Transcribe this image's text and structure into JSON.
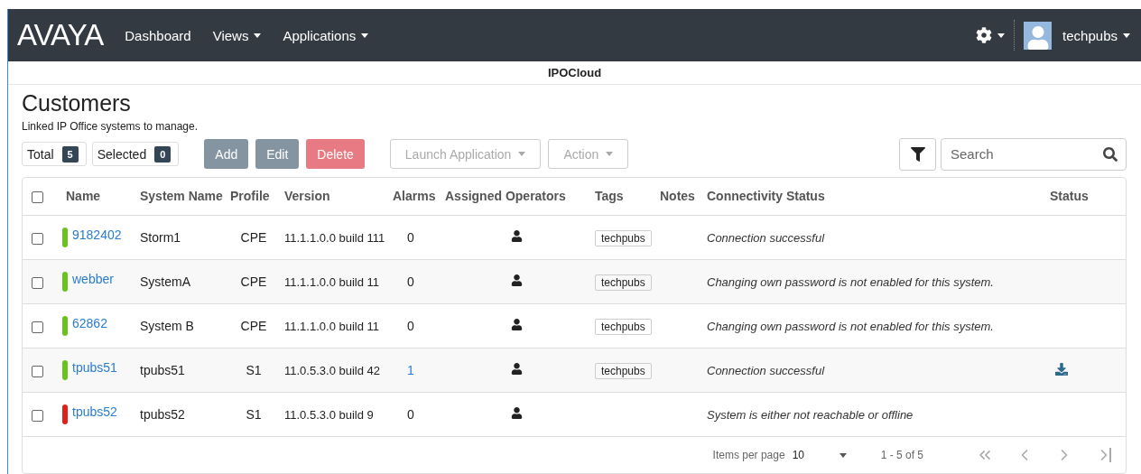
{
  "navbar": {
    "logo": "AVAYA",
    "items": [
      {
        "label": "Dashboard",
        "dropdown": false
      },
      {
        "label": "Views",
        "dropdown": true
      },
      {
        "label": "Applications",
        "dropdown": true
      }
    ],
    "user": "techpubs"
  },
  "context_title": "IPOCloud",
  "page": {
    "title": "Customers",
    "subtitle": "Linked IP Office systems to manage."
  },
  "toolbar": {
    "counters": [
      {
        "label": "Total",
        "count": "5"
      },
      {
        "label": "Selected",
        "count": "0"
      }
    ],
    "buttons": [
      {
        "label": "Add",
        "kind": "secondary",
        "disabled": false
      },
      {
        "label": "Edit",
        "kind": "secondary",
        "disabled": false
      },
      {
        "label": "Delete",
        "kind": "danger",
        "disabled": false
      }
    ],
    "dropdowns": [
      {
        "label": "Launch Application",
        "disabled": true
      },
      {
        "label": "Action",
        "disabled": true
      }
    ],
    "search": {
      "placeholder": "Search"
    }
  },
  "table": {
    "select_all": {
      "checked": false
    },
    "columns": [
      "Name",
      "System Name",
      "Profile",
      "Version",
      "Alarms",
      "Assigned Operators",
      "Tags",
      "Notes",
      "Connectivity Status",
      "Status"
    ],
    "rows": [
      {
        "checked": false,
        "color": "#6ac21c",
        "name": "9182402",
        "system_name": "Storm1",
        "profile": "CPE",
        "version": "11.1.1.0.0 build 111",
        "alarms": "0",
        "alarms_link": false,
        "tags": [
          "techpubs"
        ],
        "connectivity": "Connection successful",
        "download": false
      },
      {
        "checked": false,
        "color": "#6ac21c",
        "name": "webber",
        "system_name": "SystemA",
        "profile": "CPE",
        "version": "11.1.1.0.0 build 11",
        "alarms": "0",
        "alarms_link": false,
        "tags": [
          "techpubs"
        ],
        "connectivity": "Changing own password is not enabled for this system.",
        "download": false
      },
      {
        "checked": false,
        "color": "#6ac21c",
        "name": "62862",
        "system_name": "System B",
        "profile": "CPE",
        "version": "11.1.1.0.0 build 11",
        "alarms": "0",
        "alarms_link": false,
        "tags": [
          "techpubs"
        ],
        "connectivity": "Changing own password is not enabled for this system.",
        "download": false
      },
      {
        "checked": false,
        "color": "#6ac21c",
        "name": "tpubs51",
        "system_name": "tpubs51",
        "profile": "S1",
        "version": "11.0.5.3.0 build 42",
        "alarms": "1",
        "alarms_link": true,
        "tags": [
          "techpubs"
        ],
        "connectivity": "Connection successful",
        "download": true
      },
      {
        "checked": false,
        "color": "#e0201a",
        "name": "tpubs52",
        "system_name": "tpubs52",
        "profile": "S1",
        "version": "11.0.5.3.0 build 9",
        "alarms": "0",
        "alarms_link": false,
        "tags": [],
        "connectivity": "System is either not reachable or offline",
        "download": false
      }
    ]
  },
  "pagination": {
    "items_per_page_label": "Items per page",
    "items_per_page": "10",
    "range": "1 - 5 of 5"
  }
}
